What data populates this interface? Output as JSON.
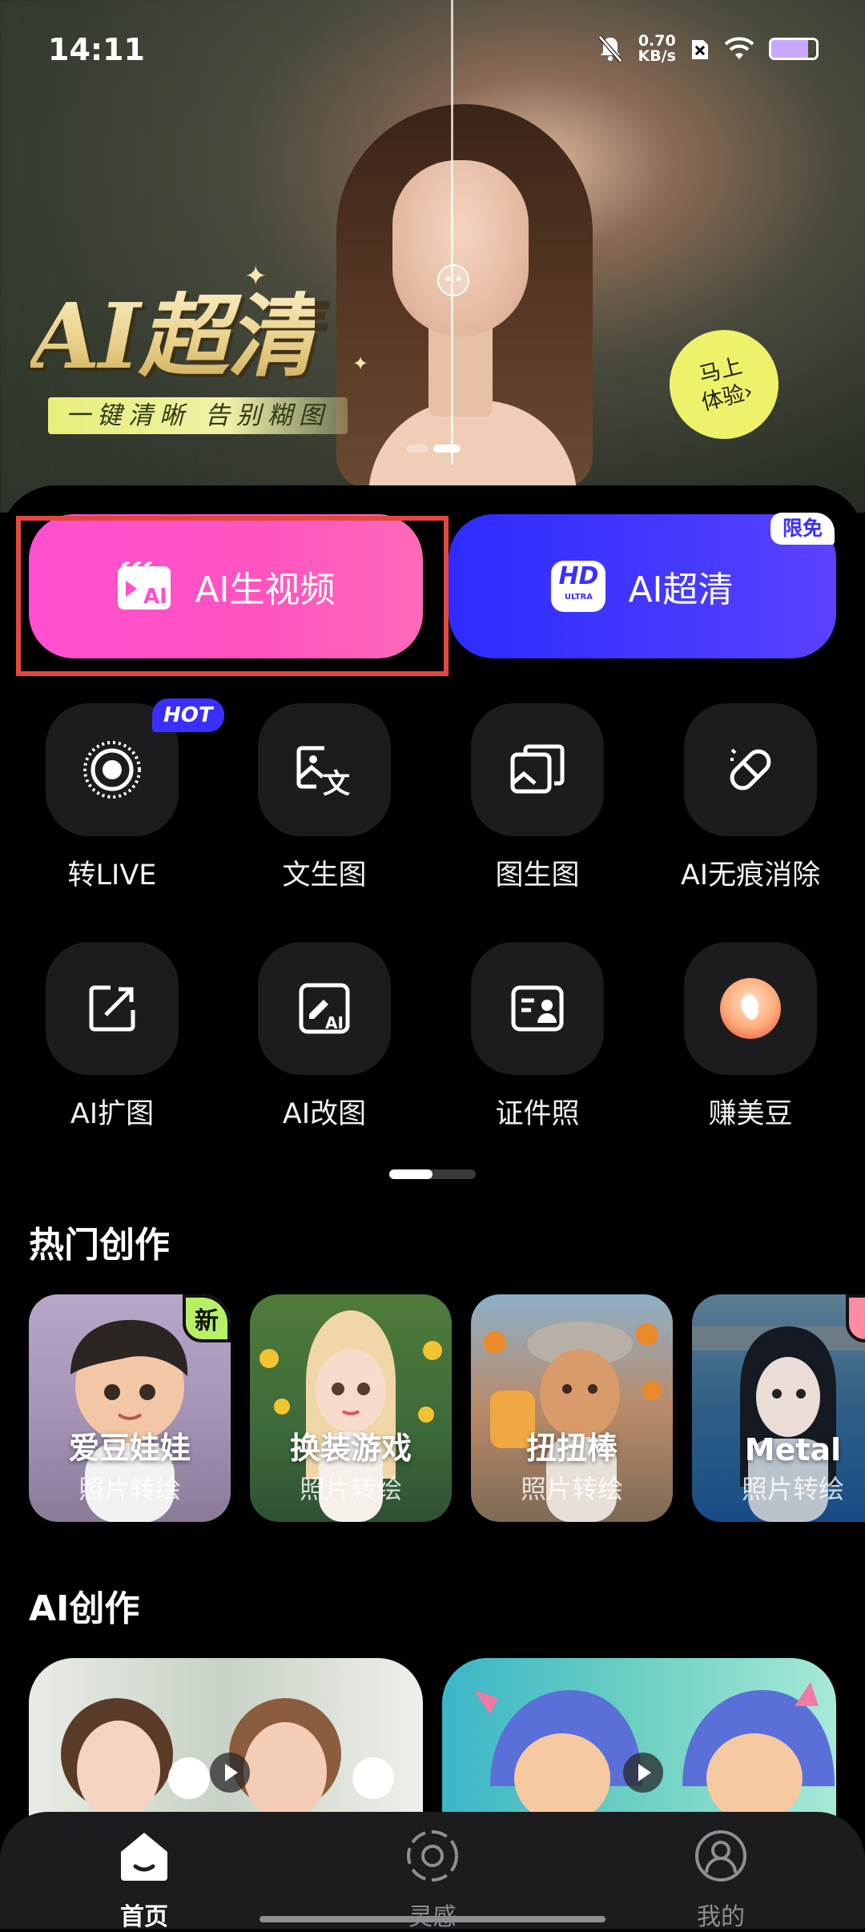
{
  "status_bar": {
    "time": "14:11",
    "speed_value": "0.70",
    "speed_unit": "KB/s"
  },
  "hero": {
    "title": "AI超清",
    "subtitle": "一键清晰  告别糊图",
    "try_line1": "马上",
    "try_line2": "体验",
    "try_arrow": "›"
  },
  "quick_actions": {
    "video": {
      "label": "AI生视频"
    },
    "hd": {
      "label": "AI超清",
      "badge": "限免",
      "icon_top": "HD",
      "icon_bottom": "ULTRA"
    }
  },
  "tools": [
    {
      "label": "转LIVE",
      "icon": "live-icon",
      "badge": "HOT"
    },
    {
      "label": "文生图",
      "icon": "text-to-image-icon"
    },
    {
      "label": "图生图",
      "icon": "image-to-image-icon"
    },
    {
      "label": "AI无痕消除",
      "icon": "eraser-icon"
    },
    {
      "label": "AI扩图",
      "icon": "expand-image-icon"
    },
    {
      "label": "AI改图",
      "icon": "ai-edit-image-icon"
    },
    {
      "label": "证件照",
      "icon": "id-photo-icon"
    },
    {
      "label": "赚美豆",
      "icon": "bean-icon"
    }
  ],
  "sections": {
    "hot": "热门创作",
    "ai": "AI创作"
  },
  "hot_cards": [
    {
      "title": "爱豆娃娃",
      "subtitle": "照片转绘",
      "badge": "新"
    },
    {
      "title": "换装游戏",
      "subtitle": "照片转绘"
    },
    {
      "title": "扭扭棒",
      "subtitle": "照片转绘"
    },
    {
      "title": "Metal",
      "subtitle": "照片转绘"
    }
  ],
  "nav": [
    {
      "label": "首页",
      "icon": "home-icon",
      "active": true
    },
    {
      "label": "灵感",
      "icon": "inspiration-icon"
    },
    {
      "label": "我的",
      "icon": "profile-icon"
    }
  ],
  "colors": {
    "video_btn": "#ff4fcf",
    "hd_btn": "#3a2fff",
    "highlight_box": "#e3483f",
    "badge_hot": "#3b2fff",
    "badge_new": "#b7f065"
  }
}
